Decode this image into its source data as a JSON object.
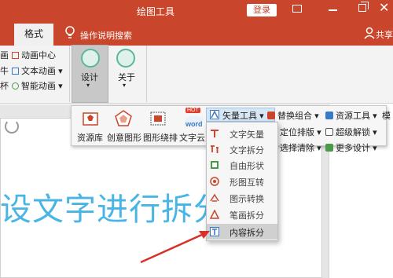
{
  "window": {
    "title": "绘图工具",
    "login_label": "登录",
    "close_glyph": "✕"
  },
  "tabs": {
    "format_label": "格式",
    "tell_me": "操作说明搜索",
    "share_label": "共享"
  },
  "ribbon": {
    "left_partial": [
      "画",
      "牛",
      "杯"
    ],
    "anim_center": "动画中心",
    "text_anim": "文本动画",
    "smart_anim": "智能动画",
    "design_label": "设计",
    "about_label": "关于",
    "caret": "▾"
  },
  "panel": {
    "resource_lib": "资源库",
    "creative_shape": "创意图形",
    "image_wrap": "图形绕排",
    "word_cloud": "文字云",
    "hot_badge": "HOT",
    "word_badge": "word",
    "vector_tool": "矢量工具",
    "replace_combo": "替换组合",
    "resource_tool": "资源工具",
    "model_cut": "模",
    "position_layout": "定位排版",
    "super_unlock": "超级解锁",
    "select_clear": "选择清除",
    "more_design": "更多设计",
    "caret": "▾"
  },
  "dropdown": {
    "items": [
      {
        "label": "文字矢量",
        "icon": "text-vector-icon"
      },
      {
        "label": "文字拆分",
        "icon": "text-split-icon"
      },
      {
        "label": "自由形状",
        "icon": "freeform-icon"
      },
      {
        "label": "形图互转",
        "icon": "shape-convert-icon"
      },
      {
        "label": "图示转换",
        "icon": "diagram-convert-icon"
      },
      {
        "label": "笔画拆分",
        "icon": "stroke-split-icon"
      },
      {
        "label": "内容拆分",
        "icon": "content-split-icon"
      }
    ],
    "highlighted_index": 6
  },
  "slide": {
    "text": "设文字进行拆分"
  },
  "colors": {
    "brand": "#c9462c",
    "slide_text": "#49b5e4",
    "accent_green": "#5ab79e",
    "arrow": "#d8312a"
  }
}
